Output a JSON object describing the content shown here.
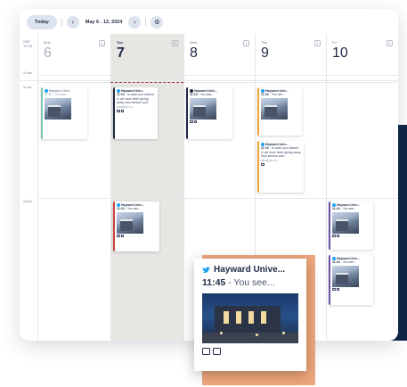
{
  "toolbar": {
    "today_label": "Today",
    "prev_icon": "chevron-left-icon",
    "prev_glyph": "‹",
    "date_range": "May 6 - 12, 2024",
    "next_icon": "chevron-right-icon",
    "next_glyph": "›",
    "settings_icon": "gear-icon",
    "settings_glyph": "⚙"
  },
  "timezone": {
    "line1": "GMT",
    "line2": "-07:00"
  },
  "days": [
    {
      "name": "Mon",
      "number": "6",
      "badge": "1"
    },
    {
      "name": "Tue",
      "number": "7",
      "badge": "2"
    },
    {
      "name": "Wed",
      "number": "8",
      "badge": "1"
    },
    {
      "name": "Thu",
      "number": "9",
      "badge": "2"
    },
    {
      "name": "Fri",
      "number": "10",
      "badge": "2"
    }
  ],
  "time_labels": [
    "10 am",
    "11 am",
    "12 pm"
  ],
  "events": {
    "account": "Hayward Univ...",
    "time": "11:10",
    "short_text": " - You see...",
    "long_text": " - In case you missed it, we have been giving away very serious and",
    "ellipsis": "(and)(our a...",
    "bar_colors": {
      "teal": "#7fc6b4",
      "navy": "#1f2a44",
      "red": "#c8453b",
      "orange": "#f0a63c",
      "purple": "#6a51a8"
    }
  },
  "featured": {
    "account": "Hayward Unive...",
    "time": "11:45",
    "text": " - You see...",
    "network_icon": "twitter-icon",
    "accent_color": "#efa77c"
  }
}
